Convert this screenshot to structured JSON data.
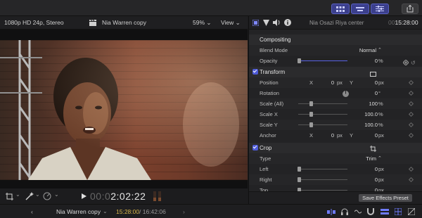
{
  "viewer": {
    "format": "1080p HD 24p, Stereo",
    "clip_title": "Nia Warren copy",
    "zoom": "59%",
    "view_menu": "View",
    "timecode_dim": "00:0",
    "timecode": "2:02:22"
  },
  "inspector": {
    "clip_name": "Nia Osazi Riya center",
    "clip_timecode": "15:28:00",
    "sections": {
      "compositing": "Compositing",
      "transform": "Transform",
      "crop": "Crop"
    },
    "blend_mode": {
      "label": "Blend Mode",
      "value": "Normal"
    },
    "opacity": {
      "label": "Opacity",
      "value": "0",
      "unit": "%",
      "level": 0.0
    },
    "position": {
      "label": "Position",
      "x_label": "X",
      "x_value": "0",
      "x_unit": "px",
      "y_label": "Y",
      "y_value": "0",
      "y_unit": "px"
    },
    "rotation": {
      "label": "Rotation",
      "value": "0",
      "unit": "°"
    },
    "scale_all": {
      "label": "Scale (All)",
      "value": "100",
      "unit": "%"
    },
    "scale_x": {
      "label": "Scale X",
      "value": "100.0",
      "unit": "%"
    },
    "scale_y": {
      "label": "Scale Y",
      "value": "100.0",
      "unit": "%"
    },
    "anchor": {
      "label": "Anchor",
      "x_label": "X",
      "x_value": "0",
      "x_unit": "px",
      "y_label": "Y",
      "y_value": "0",
      "y_unit": "px"
    },
    "crop_type": {
      "label": "Type",
      "value": "Trim"
    },
    "crop_left": {
      "label": "Left",
      "value": "0",
      "unit": "px"
    },
    "crop_right": {
      "label": "Right",
      "value": "0",
      "unit": "px"
    },
    "crop_top": {
      "label": "Top",
      "value": "0",
      "unit": "px"
    },
    "save_preset": "Save Effects Preset"
  },
  "bottom": {
    "project": "Nia Warren copy",
    "time_current": "15:28:00",
    "time_total": "/ 16:42:06"
  },
  "colors": {
    "accent": "#4e5bd7",
    "timecode_yellow": "#d9b64a"
  }
}
